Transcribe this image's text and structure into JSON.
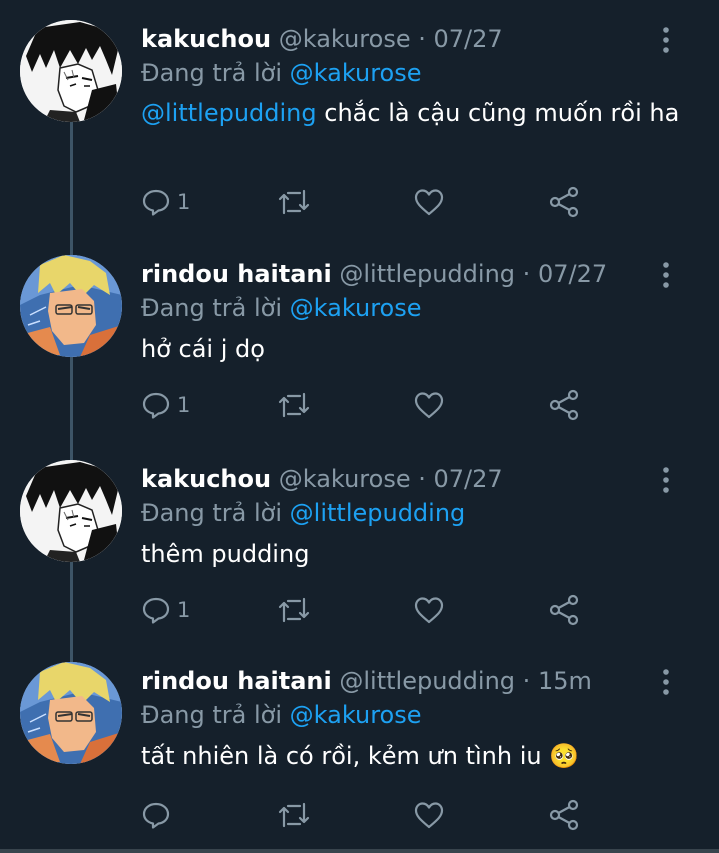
{
  "tweets": [
    {
      "name": "kakuchou",
      "handle": "@kakurose",
      "time": "07/27",
      "reply_prefix": "Đang trả lời",
      "reply_to": "@kakurose",
      "mention": "@littlepudding",
      "text": " chắc là cậu cũng muốn rồi ha",
      "reply_count": "1"
    },
    {
      "name": "rindou haitani",
      "handle": "@littlepudding",
      "time": "07/27",
      "reply_prefix": "Đang trả lời",
      "reply_to": "@kakurose",
      "text": "hở cái j dọ",
      "reply_count": "1"
    },
    {
      "name": "kakuchou",
      "handle": "@kakurose",
      "time": "07/27",
      "reply_prefix": "Đang trả lời",
      "reply_to": "@littlepudding",
      "text": "thêm pudding",
      "reply_count": "1"
    },
    {
      "name": "rindou haitani",
      "handle": "@littlepudding",
      "time": "15m",
      "reply_prefix": "Đang trả lời",
      "reply_to": "@kakurose",
      "text": "tất nhiên là có rồi, kẻm ưn tình iu 🥺",
      "reply_count": ""
    }
  ],
  "separator": "·",
  "icons": {
    "reply": "reply-icon",
    "retweet": "retweet-icon",
    "like": "heart-icon",
    "share": "share-icon",
    "more": "more-vertical-icon"
  },
  "colors": {
    "background": "#15202b",
    "mention": "#1da1f2",
    "muted": "#8899a6",
    "thread_line": "#3d5466"
  }
}
